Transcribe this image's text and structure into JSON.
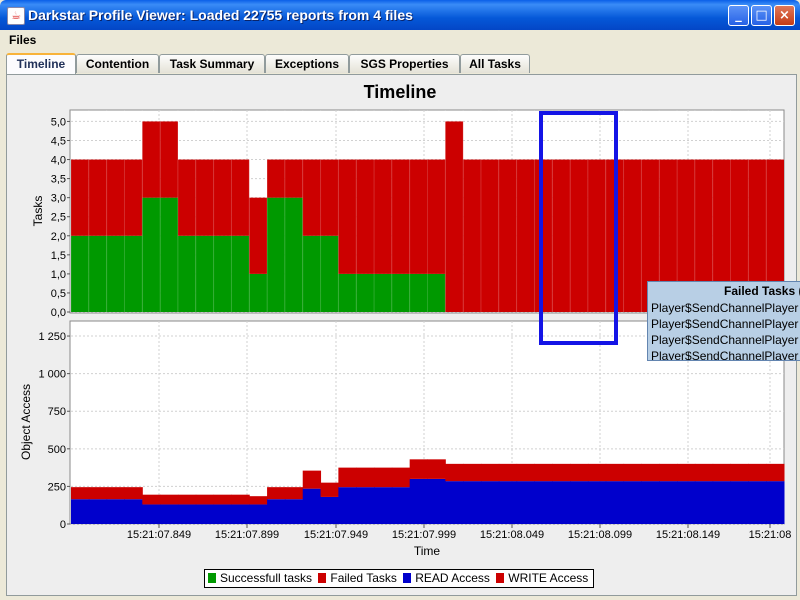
{
  "window": {
    "title": "Darkstar Profile Viewer: Loaded 22755 reports from 4 files",
    "controls": [
      "_",
      "□",
      "×"
    ]
  },
  "menu": {
    "files": "Files"
  },
  "tabs": [
    "Timeline",
    "Contention",
    "Task Summary",
    "Exceptions",
    "SGS Properties",
    "All Tasks"
  ],
  "active_tab": "Timeline",
  "chart": {
    "title": "Timeline",
    "xlabel": "Time"
  },
  "colors": {
    "success": "#009900",
    "failed": "#CC0000",
    "read": "#0000CC",
    "write": "#CC0000",
    "highlight": "#1414E6"
  },
  "chart_data": [
    {
      "type": "bar",
      "stacked": true,
      "ylabel": "Tasks",
      "ylim": [
        0,
        5.3
      ],
      "yticks": [
        "0,0",
        "0,5",
        "1,0",
        "1,5",
        "2,0",
        "2,5",
        "3,0",
        "3,5",
        "4,0",
        "4,5",
        "5,0"
      ],
      "series": [
        {
          "name": "Successfull tasks",
          "values": [
            2,
            2,
            2,
            2,
            3,
            3,
            2,
            2,
            2,
            2,
            1,
            3,
            3,
            2,
            2,
            1,
            1,
            1,
            1,
            1,
            1,
            0,
            0,
            0,
            0,
            0,
            0,
            0,
            0,
            0,
            0,
            0,
            0,
            0,
            0,
            0,
            0,
            0,
            0,
            0
          ]
        },
        {
          "name": "Failed Tasks",
          "values": [
            2,
            2,
            2,
            2,
            2,
            2,
            2,
            2,
            2,
            2,
            2,
            1,
            1,
            2,
            2,
            3,
            3,
            3,
            3,
            3,
            3,
            5,
            4,
            4,
            4,
            4,
            4,
            4,
            4,
            4,
            4,
            4,
            4,
            4,
            4,
            4,
            4,
            4,
            4,
            4
          ]
        }
      ]
    },
    {
      "type": "area",
      "stacked": true,
      "ylabel": "Object Access",
      "ylim": [
        0,
        1350
      ],
      "yticks": [
        "0",
        "250",
        "500",
        "750",
        "1 000",
        "1 250"
      ],
      "x_ticks": [
        "15:21:07.849",
        "15:21:07.899",
        "15:21:07.949",
        "15:21:07.999",
        "15:21:08.049",
        "15:21:08.099",
        "15:21:08.149",
        "15:21:08"
      ],
      "series": [
        {
          "name": "READ Access",
          "values": [
            165,
            165,
            165,
            165,
            130,
            130,
            130,
            130,
            130,
            130,
            130,
            165,
            165,
            235,
            180,
            245,
            245,
            245,
            245,
            300,
            300,
            285,
            285,
            285,
            285,
            285,
            285,
            285,
            285,
            285,
            285,
            285,
            285,
            285,
            285,
            285,
            285,
            285,
            285,
            285
          ]
        },
        {
          "name": "WRITE Access",
          "values": [
            80,
            80,
            80,
            80,
            65,
            65,
            65,
            65,
            65,
            65,
            55,
            80,
            80,
            120,
            95,
            130,
            130,
            130,
            130,
            130,
            130,
            115,
            115,
            115,
            115,
            115,
            115,
            115,
            115,
            115,
            115,
            115,
            115,
            115,
            115,
            115,
            115,
            115,
            115,
            115
          ]
        }
      ]
    }
  ],
  "legend": [
    "Successfull tasks",
    "Failed Tasks",
    "READ Access",
    "WRITE Access"
  ],
  "tooltip": {
    "title": "Failed Tasks (",
    "rows": [
      "Player$SendChannelPlayer",
      "Player$SendChannelPlayer",
      "Player$SendChannelPlayer",
      "Player$SendChannelPlayer"
    ]
  }
}
